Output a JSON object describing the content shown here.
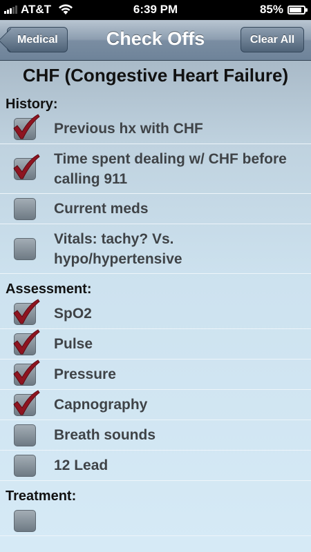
{
  "status_bar": {
    "carrier": "AT&T",
    "time": "6:39 PM",
    "battery": "85%"
  },
  "nav": {
    "back_label": "Medical",
    "title": "Check Offs",
    "clear_label": "Clear All"
  },
  "page_title": "CHF (Congestive Heart Failure)",
  "sections": {
    "history": {
      "header": "History:",
      "items": [
        {
          "label": "Previous hx with CHF",
          "checked": true
        },
        {
          "label": "Time spent dealing w/ CHF before calling 911",
          "checked": true
        },
        {
          "label": "Current meds",
          "checked": false
        },
        {
          "label": "Vitals: tachy? Vs. hypo/hypertensive",
          "checked": false
        }
      ]
    },
    "assessment": {
      "header": "Assessment:",
      "items": [
        {
          "label": "SpO2",
          "checked": true
        },
        {
          "label": "Pulse",
          "checked": true
        },
        {
          "label": "Pressure",
          "checked": true
        },
        {
          "label": "Capnography",
          "checked": true
        },
        {
          "label": "Breath sounds",
          "checked": false
        },
        {
          "label": "12 Lead",
          "checked": false
        }
      ]
    },
    "treatment": {
      "header": "Treatment:"
    }
  },
  "colors": {
    "checkmark": "#8e1420",
    "checkbox": "#8e9aa4",
    "nav_bar": "#8d9eb0"
  }
}
